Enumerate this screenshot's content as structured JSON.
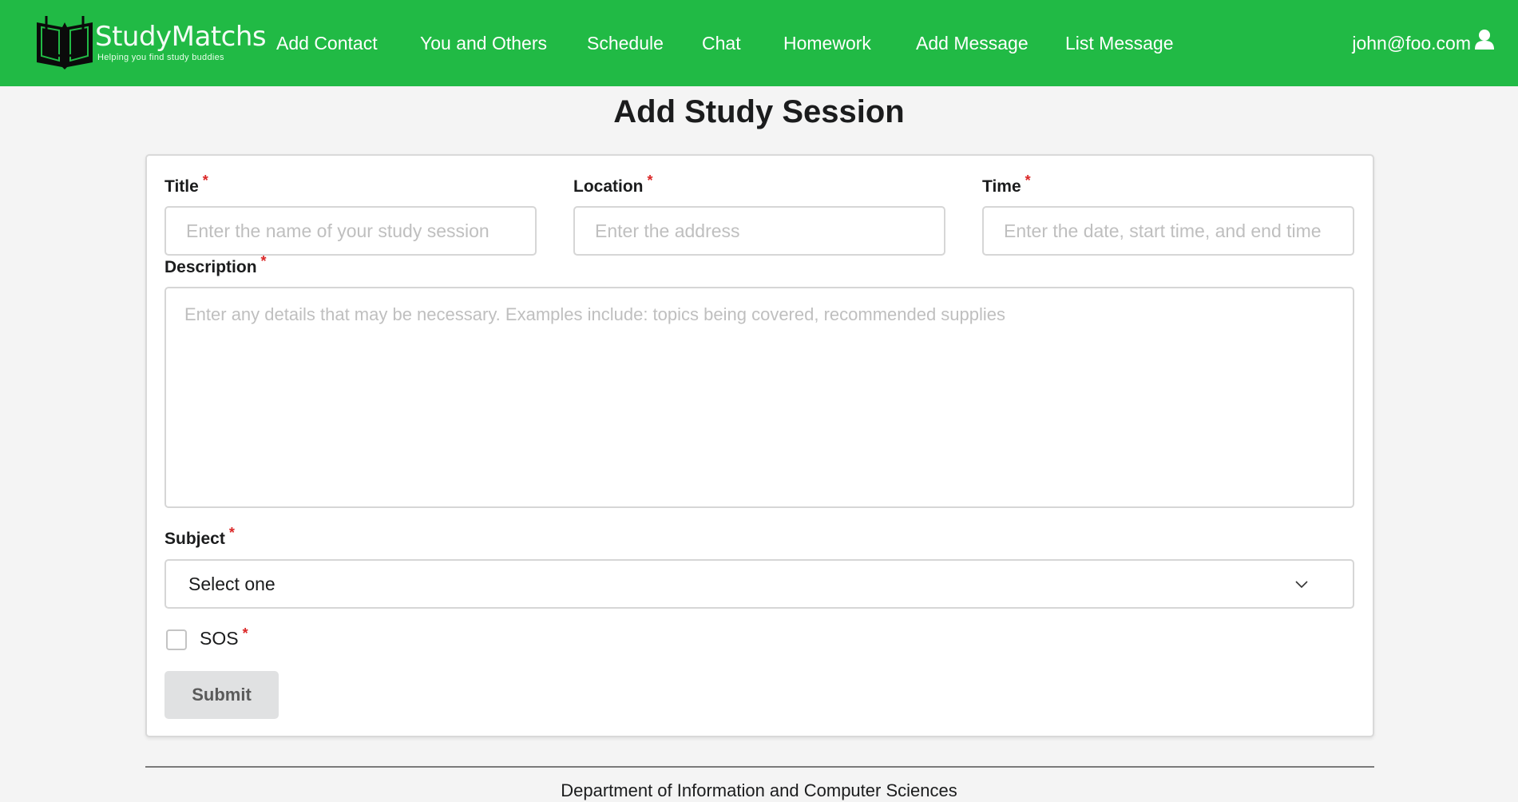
{
  "navbar": {
    "brand": {
      "name": "StudyMatchs",
      "tagline": "Helping you find study buddies",
      "icon": "open-book-icon"
    },
    "links": [
      {
        "label": "Add Contact"
      },
      {
        "label": "You and Others"
      },
      {
        "label": "Schedule"
      },
      {
        "label": "Chat"
      },
      {
        "label": "Homework"
      },
      {
        "label": "Add Message"
      },
      {
        "label": "List Message"
      }
    ],
    "user": {
      "email": "john@foo.com",
      "icon": "user-icon"
    }
  },
  "page": {
    "title": "Add Study Session"
  },
  "form": {
    "title_field": {
      "label": "Title",
      "required_mark": "*",
      "placeholder": "Enter the name of your study session",
      "value": ""
    },
    "location_field": {
      "label": "Location",
      "required_mark": "*",
      "placeholder": "Enter the address",
      "value": ""
    },
    "time_field": {
      "label": "Time",
      "required_mark": "*",
      "placeholder": "Enter the date, start time, and end time",
      "value": ""
    },
    "description_field": {
      "label": "Description",
      "required_mark": "*",
      "placeholder": "Enter any details that may be necessary. Examples include: topics being covered, recommended supplies",
      "value": ""
    },
    "subject_field": {
      "label": "Subject",
      "required_mark": "*",
      "selected": "Select one",
      "icon": "chevron-down-icon"
    },
    "sos_field": {
      "label": "SOS",
      "required_mark": "*",
      "checked": false
    },
    "submit_label": "Submit"
  },
  "footer": {
    "text": "Department of Information and Computer Sciences"
  },
  "colors": {
    "navbar_bg": "#21ba45",
    "required": "#db2828",
    "page_bg": "#f4f4f4",
    "button_bg": "#e0e1e2"
  }
}
